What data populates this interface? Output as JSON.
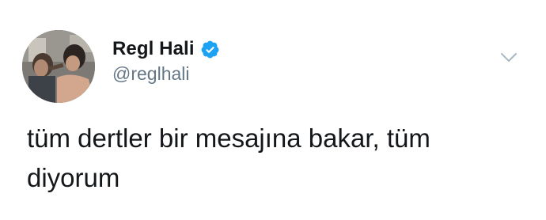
{
  "tweet": {
    "author": {
      "display_name": "Regl Hali",
      "handle": "@reglhali",
      "verified": true,
      "avatar_icon": "profile-photo"
    },
    "text_line_1": "tüm dertler bir mesajına bakar, tüm",
    "text_line_2": "diyorum",
    "menu_icon": "chevron-down-icon"
  },
  "colors": {
    "background": "#ffffff",
    "text": "#14171a",
    "secondary_text": "#657786",
    "verified_badge": "#1da1f2",
    "caret": "#aab8c2"
  }
}
